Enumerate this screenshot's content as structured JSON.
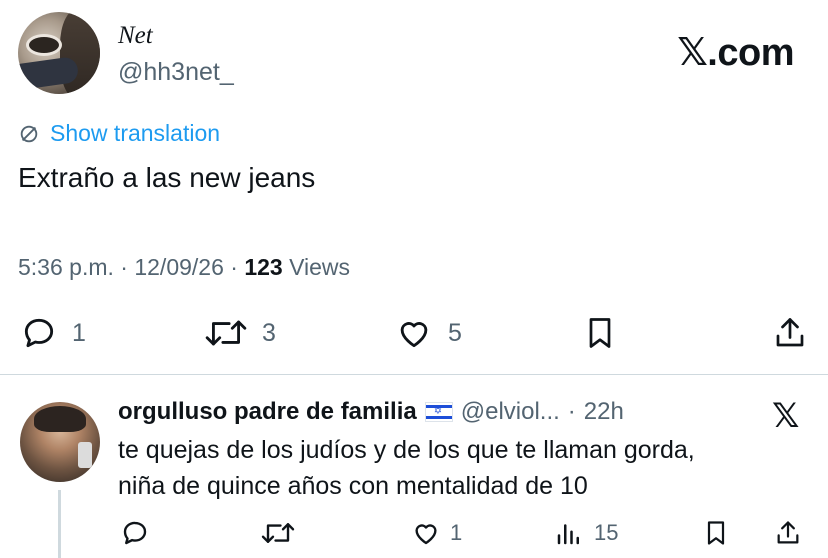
{
  "tweet": {
    "display_name": "Net",
    "handle": "@hh3net_",
    "brand": "𝕏.com",
    "translate_label": "Show translation",
    "text": "Extraño a las new jeans",
    "time": "5:36 p.m.",
    "date": "12/09/26",
    "views_count": "123",
    "views_label": "Views",
    "separator": "·",
    "actions": {
      "reply_count": "1",
      "retweet_count": "3",
      "like_count": "5"
    }
  },
  "reply": {
    "display_name": "orgulluso padre de familia",
    "flag_icon": "israel-flag-icon",
    "handle": "@elviol...",
    "separator": "·",
    "time": "22h",
    "line1": "te quejas de los judíos y de los que te llaman gorda,",
    "line2": "niña de quince años con mentalidad de 10",
    "actions": {
      "like_count": "1",
      "views_count": "15"
    }
  },
  "colors": {
    "accent": "#1d9bf0",
    "text": "#0f1419",
    "secondary": "#536471",
    "divider": "#cfd9de"
  }
}
